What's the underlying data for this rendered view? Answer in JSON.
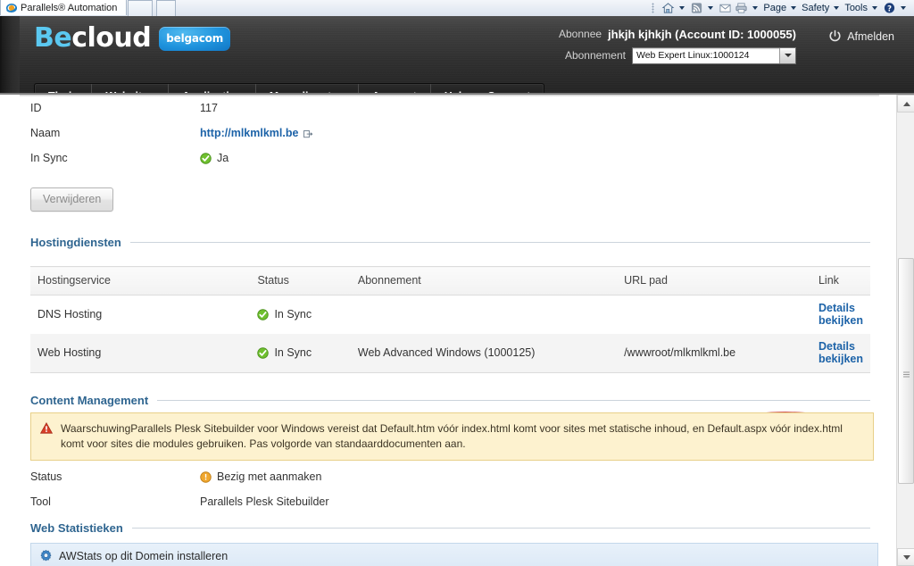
{
  "browser": {
    "tab_title": "Parallels® Automation",
    "toolbar_items": [
      {
        "label": "",
        "icon": "home-icon",
        "has_caret": true
      },
      {
        "label": "",
        "icon": "rss-feed-icon",
        "has_caret": true
      },
      {
        "label": "",
        "icon": "mail-icon",
        "has_caret": false
      },
      {
        "label": "",
        "icon": "print-icon",
        "has_caret": true
      },
      {
        "label": "Page",
        "icon": "",
        "has_caret": true
      },
      {
        "label": "Safety",
        "icon": "",
        "has_caret": true
      },
      {
        "label": "Tools",
        "icon": "",
        "has_caret": true
      },
      {
        "label": "",
        "icon": "help-icon",
        "has_caret": true
      }
    ]
  },
  "header": {
    "logo_be": "Be",
    "logo_cloud": "cloud",
    "logo_badge": "belgacom",
    "subscriber_label": "Abonnee",
    "subscriber_value": "jhkjh kjhkjh (Account ID: 1000055)",
    "subscription_label": "Abonnement",
    "subscription_value": "Web Expert Linux:1000124",
    "logout_label": "Afmelden",
    "accent_blue": "#5bc8f0",
    "badge_blue": "#1f93dd"
  },
  "nav": {
    "items": [
      {
        "label": "Thuis",
        "name": "nav-thuis"
      },
      {
        "label": "Websites",
        "name": "nav-websites"
      },
      {
        "label": "Applicaties",
        "name": "nav-applicaties"
      },
      {
        "label": "Meer diensten",
        "name": "nav-meer-diensten"
      },
      {
        "label": "Account",
        "name": "nav-account"
      },
      {
        "label": "Help en Support",
        "name": "nav-help-en-support"
      }
    ]
  },
  "details": {
    "id_label": "ID",
    "id_value": "117",
    "name_label": "Naam",
    "name_value": "http://mlkmlkml.be",
    "insync_label": "In Sync",
    "insync_value": "Ja",
    "delete_button": "Verwijderen"
  },
  "hosting": {
    "section_title": "Hostingdiensten",
    "columns": [
      "Hostingservice",
      "Status",
      "Abonnement",
      "URL pad",
      "Link"
    ],
    "rows": [
      {
        "service": "DNS Hosting",
        "status": "In Sync",
        "status_icon": "check-circle-icon",
        "subscription": "",
        "url_path": "",
        "link": "Details bekijken",
        "annotated": false
      },
      {
        "service": "Web Hosting",
        "status": "In Sync",
        "status_icon": "check-circle-icon",
        "subscription": "Web Advanced Windows (1000125)",
        "url_path": "/wwwroot/mlkmlkml.be",
        "link": "Details bekijken",
        "annotated": true
      }
    ]
  },
  "content_management": {
    "section_title": "Content Management",
    "warning_text": "WaarschuwingParallels Plesk Sitebuilder voor Windows vereist dat Default.htm vóór index.html komt voor sites met statische inhoud, en Default.aspx vóór index.html komt voor sites die modules gebruiken. Pas volgorde van standaarddocumenten aan.",
    "status_label": "Status",
    "status_value": "Bezig met aanmaken",
    "tool_label": "Tool",
    "tool_value": "Parallels Plesk Sitebuilder"
  },
  "web_statistics": {
    "section_title": "Web Statistieken",
    "install_label": "AWStats op dit Domein installeren"
  },
  "annotation": {
    "color": "#c62525",
    "target": "Details bekijken"
  }
}
